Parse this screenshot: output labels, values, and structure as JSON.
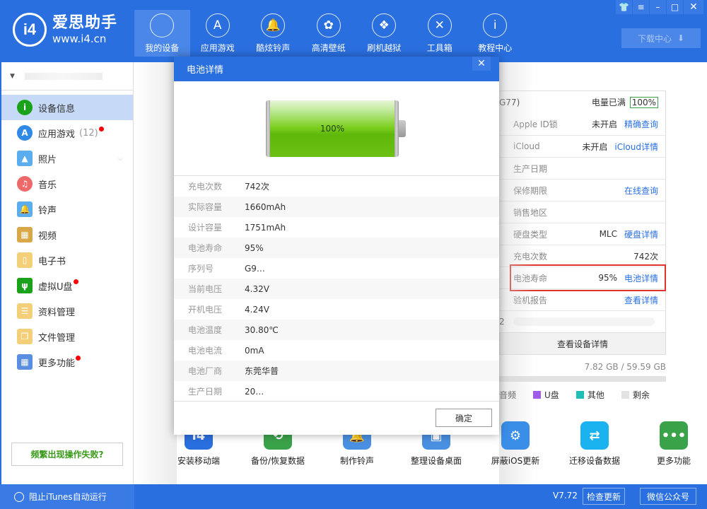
{
  "app": {
    "logo_mark": "i4",
    "logo_name": "爱思助手",
    "logo_url": "www.i4.cn"
  },
  "nav": [
    {
      "label": "我的设备",
      "icon": "apple-icon",
      "glyph": "",
      "active": true
    },
    {
      "label": "应用游戏",
      "icon": "app-store-icon",
      "glyph": "A"
    },
    {
      "label": "酷炫铃声",
      "icon": "bell-icon",
      "glyph": "🔔"
    },
    {
      "label": "高清壁纸",
      "icon": "flower-icon",
      "glyph": "✿"
    },
    {
      "label": "刷机越狱",
      "icon": "dropbox-icon",
      "glyph": "❖"
    },
    {
      "label": "工具箱",
      "icon": "tools-icon",
      "glyph": "✕"
    },
    {
      "label": "教程中心",
      "icon": "info-icon",
      "glyph": "i"
    }
  ],
  "window_controls": {
    "skin": "👕",
    "menu": "≡",
    "minimize": "–",
    "maximize": "□",
    "close": "✕"
  },
  "download_center": {
    "label": "下载中心",
    "icon": "⬇"
  },
  "sidebar": {
    "device_toggle": "▼",
    "items": [
      {
        "label": "设备信息",
        "icon": "info-circle-icon",
        "glyph": "i",
        "color": "#1aa31a",
        "active": true
      },
      {
        "label": "应用游戏",
        "count": "(12)",
        "icon": "app-store-icon",
        "glyph": "A",
        "color": "#2e8ae6",
        "dot": true
      },
      {
        "label": "照片",
        "icon": "photo-icon",
        "glyph": "▲",
        "color": "#5aaef0",
        "chevron": "⌵"
      },
      {
        "label": "音乐",
        "icon": "music-icon",
        "glyph": "♫",
        "color": "#ee6a6a"
      },
      {
        "label": "铃声",
        "icon": "bell-icon",
        "glyph": "🔔",
        "color": "#5aaef0"
      },
      {
        "label": "视频",
        "icon": "video-icon",
        "glyph": "▦",
        "color": "#d8a848"
      },
      {
        "label": "电子书",
        "icon": "book-icon",
        "glyph": "▯",
        "color": "#f3cf7a"
      },
      {
        "label": "虚拟U盘",
        "icon": "usb-icon",
        "glyph": "ψ",
        "color": "#1aa31a",
        "dot": true
      },
      {
        "label": "资料管理",
        "icon": "contacts-icon",
        "glyph": "☰",
        "color": "#f3cf7a"
      },
      {
        "label": "文件管理",
        "icon": "files-icon",
        "glyph": "❐",
        "color": "#f3cf7a"
      },
      {
        "label": "更多功能",
        "icon": "grid-icon",
        "glyph": "▦",
        "color": "#5a8ee0",
        "dot": true
      }
    ],
    "fail_button": "频繁出现操作失败?"
  },
  "device_info": {
    "model_suffix": "G77)",
    "battery_status": "电量已满",
    "battery_level": "100%",
    "rows": [
      {
        "label": "Apple ID锁",
        "value": "未开启",
        "link": "精确查询"
      },
      {
        "label": "iCloud",
        "value": "未开启",
        "link": "iCloud详情"
      },
      {
        "label": "生产日期",
        "value": "",
        "link": ""
      },
      {
        "label": "保修期限",
        "value": "",
        "link": "在线查询"
      },
      {
        "label": "销售地区",
        "value": "",
        "link": ""
      },
      {
        "label": "硬盘类型",
        "value": "MLC",
        "link": "硬盘详情"
      },
      {
        "label": "充电次数",
        "value": "742次",
        "link": ""
      },
      {
        "label": "电池寿命",
        "value": "95%",
        "link": "电池详情"
      },
      {
        "label": "验机报告",
        "value": "",
        "link": "查看详情"
      }
    ],
    "blurred_prefix": "2",
    "view_details": "查看设备详情"
  },
  "storage": {
    "usage": "7.82 GB / 59.59 GB",
    "used_fraction": 0.131,
    "legend": [
      {
        "label": "音频",
        "color": ""
      },
      {
        "label": "U盘",
        "color": "#a05ce8"
      },
      {
        "label": "其他",
        "color": "#1fbfb8"
      },
      {
        "label": "剩余",
        "color": "#e2e2e2"
      }
    ]
  },
  "tools": [
    {
      "label": "安装移动端",
      "icon": "i4-mobile-icon",
      "glyph": "i4",
      "color": "#2a6fe0"
    },
    {
      "label": "备份/恢复数据",
      "icon": "backup-icon",
      "glyph": "⟲",
      "color": "#3aa34a"
    },
    {
      "label": "制作铃声",
      "icon": "bell-icon",
      "glyph": "🔔",
      "color": "#4a90e2"
    },
    {
      "label": "整理设备桌面",
      "icon": "desktop-icon",
      "glyph": "▣",
      "color": "#4a90e2"
    },
    {
      "label": "屏蔽iOS更新",
      "icon": "gear-icon",
      "glyph": "⚙",
      "color": "#3a8ee8"
    },
    {
      "label": "迁移设备数据",
      "icon": "migrate-icon",
      "glyph": "⇄",
      "color": "#1ab3f0"
    },
    {
      "label": "更多功能",
      "icon": "more-icon",
      "glyph": "•••",
      "color": "#3aa34a"
    }
  ],
  "statusbar": {
    "itunes_toggle": "阻止iTunes自动运行",
    "version": "V7.72",
    "check_update": "检查更新",
    "wechat": "微信公众号"
  },
  "dialog": {
    "title": "电池详情",
    "close": "✕",
    "battery_percent": "100%",
    "battery_fraction": 1.0,
    "rows": [
      {
        "label": "充电次数",
        "value": "742次"
      },
      {
        "label": "实际容量",
        "value": "1660mAh"
      },
      {
        "label": "设计容量",
        "value": "1751mAh"
      },
      {
        "label": "电池寿命",
        "value": "95%"
      },
      {
        "label": "序列号",
        "value": "G9…"
      },
      {
        "label": "当前电压",
        "value": "4.32V"
      },
      {
        "label": "开机电压",
        "value": "4.24V"
      },
      {
        "label": "电池温度",
        "value": "30.80℃"
      },
      {
        "label": "电池电流",
        "value": "0mA"
      },
      {
        "label": "电池厂商",
        "value": "东莞华普"
      },
      {
        "label": "生产日期",
        "value": "20…"
      }
    ],
    "ok": "确定"
  }
}
